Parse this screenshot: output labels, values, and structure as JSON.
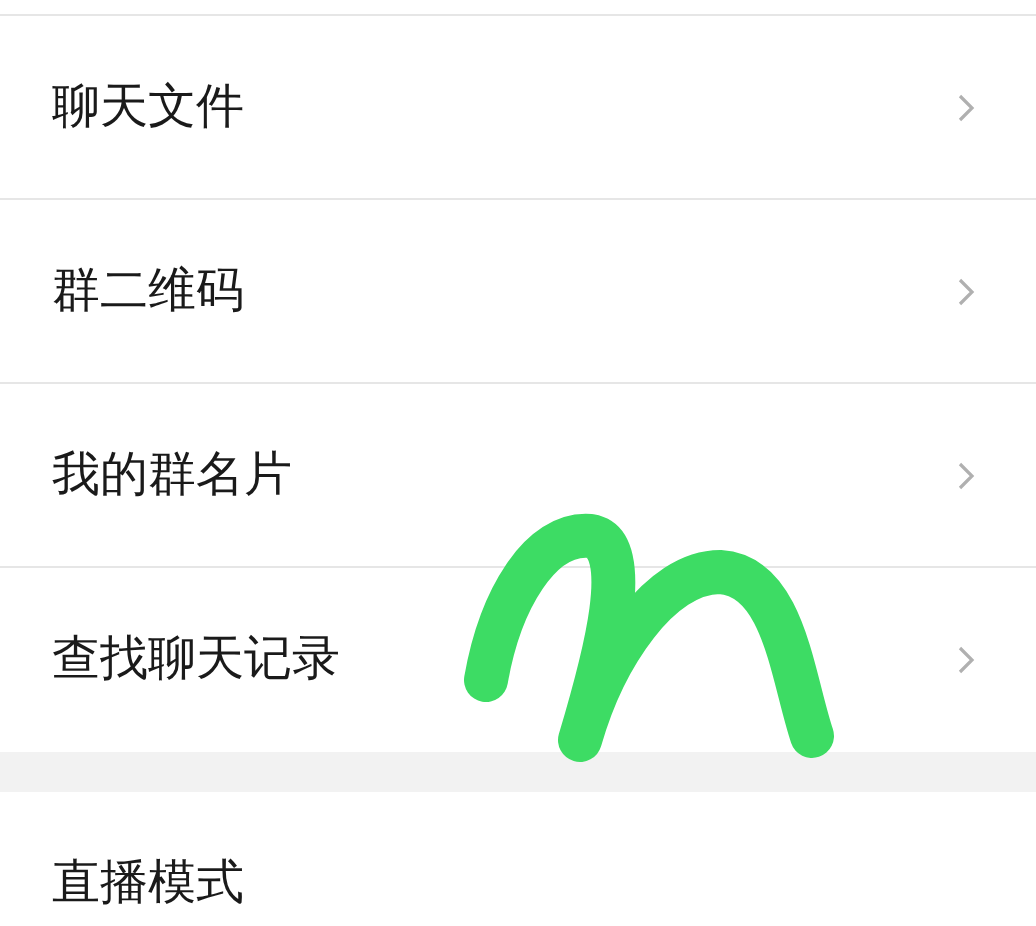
{
  "groups": [
    {
      "items": [
        {
          "label": "聊天文件",
          "kind": "nav"
        },
        {
          "label": "群二维码",
          "kind": "nav"
        },
        {
          "label": "我的群名片",
          "kind": "nav"
        },
        {
          "label": "查找聊天记录",
          "kind": "nav"
        }
      ]
    },
    {
      "items": [
        {
          "label": "直播模式",
          "kind": "plain"
        }
      ]
    }
  ]
}
